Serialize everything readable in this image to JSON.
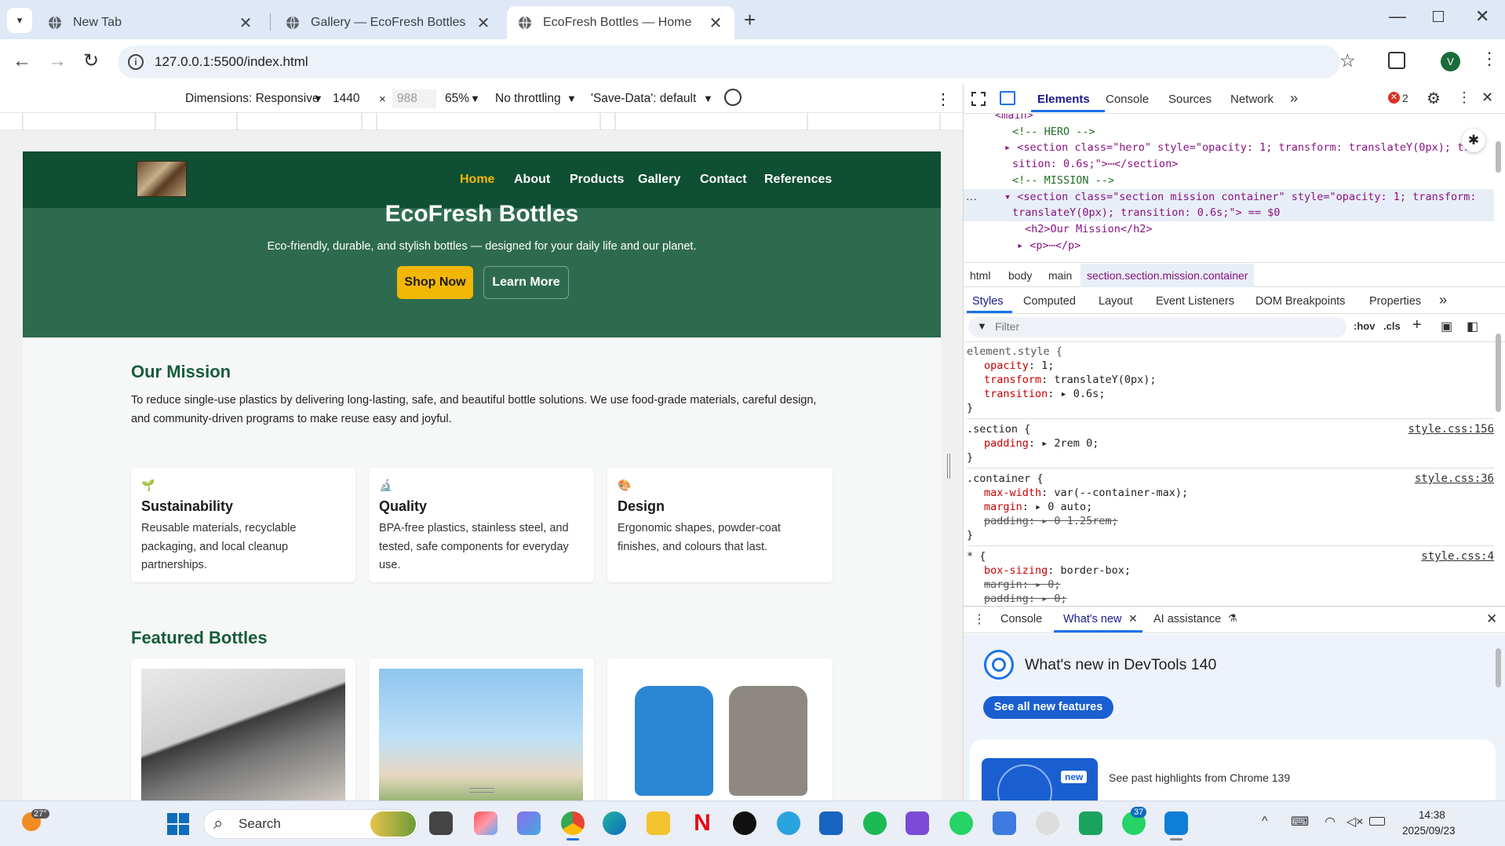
{
  "tabs": [
    {
      "title": "New Tab",
      "active": false
    },
    {
      "title": "Gallery — EcoFresh Bottles",
      "active": false
    },
    {
      "title": "EcoFresh Bottles — Home",
      "active": true
    }
  ],
  "address": {
    "url": "127.0.0.1:5500/index.html"
  },
  "profile": {
    "initial": "V"
  },
  "device_toolbar": {
    "dimensions": "Dimensions: Responsive",
    "width": "1440",
    "height_placeholder": "988",
    "times": "×",
    "zoom": "65%",
    "throttle": "No throttling",
    "save_data": "'Save-Data': default"
  },
  "site": {
    "nav": [
      "Home",
      "About",
      "Products",
      "Gallery",
      "Contact",
      "References"
    ],
    "hero_title": "EcoFresh Bottles",
    "hero_subtitle": "Eco-friendly, durable, and stylish bottles — designed for your daily life and our planet.",
    "shop_btn": "Shop Now",
    "learn_btn": "Learn More",
    "mission_title": "Our Mission",
    "mission_text": "To reduce single-use plastics by delivering long-lasting, safe, and beautiful bottle solutions. We use food-grade materials, careful design, and community-driven programs to make reuse easy and joyful.",
    "features": [
      {
        "icon": "🌱",
        "title": "Sustainability",
        "text": "Reusable materials, recyclable packaging, and local cleanup partnerships."
      },
      {
        "icon": "🔬",
        "title": "Quality",
        "text": "BPA-free plastics, stainless steel, and tested, safe components for everyday use."
      },
      {
        "icon": "🎨",
        "title": "Design",
        "text": "Ergonomic shapes, powder-coat finishes, and colours that last."
      }
    ],
    "featured_title": "Featured Bottles"
  },
  "devtools": {
    "tabs": [
      "Elements",
      "Console",
      "Sources",
      "Network"
    ],
    "active_tab": "Elements",
    "error_count": "2",
    "dom_lines": [
      "<main>",
      "<!-- HERO -->",
      "<section class=\"hero\" style=\"opacity: 1; transform: translateY(0px); tra",
      "sition: 0.6s;\">⋯</section>",
      "<!-- MISSION -->",
      "<section class=\"section mission container\" style=\"opacity: 1; transform:",
      "translateY(0px); transition: 0.6s;\"> == $0",
      "<h2>Our Mission</h2>",
      "<p>⋯</p>"
    ],
    "breadcrumbs": [
      "html",
      "body",
      "main",
      "section.section.mission.container"
    ],
    "style_tabs": [
      "Styles",
      "Computed",
      "Layout",
      "Event Listeners",
      "DOM Breakpoints",
      "Properties"
    ],
    "filter_placeholder": "Filter",
    "hov": ":hov",
    "cls": ".cls",
    "rules": [
      {
        "selector": "element.style {",
        "source": "",
        "decls": [
          [
            "opacity",
            "1;"
          ],
          [
            "transform",
            "translateY(0px);"
          ],
          [
            "transition",
            "▸ 0.6s;"
          ]
        ]
      },
      {
        "selector": ".section {",
        "source": "style.css:156",
        "decls": [
          [
            "padding",
            "▸ 2rem 0;"
          ]
        ]
      },
      {
        "selector": ".container {",
        "source": "style.css:36",
        "decls": [
          [
            "max-width",
            "var(--container-max);"
          ],
          [
            "margin",
            "▸ 0 auto;"
          ],
          [
            "padding",
            "▸ 0 1.25rem;"
          ]
        ]
      },
      {
        "selector": "* {",
        "source": "style.css:4",
        "decls": [
          [
            "box-sizing",
            "border-box;"
          ],
          [
            "margin",
            "▸ 0;"
          ],
          [
            "padding",
            "▸ 0;"
          ]
        ]
      }
    ],
    "drawer_tabs": [
      "Console",
      "What's new",
      "AI assistance"
    ],
    "whats_new_title": "What's new in DevTools 140",
    "see_all": "See all new features",
    "new_badge": "new",
    "past_highlights": "See past highlights from Chrome 139"
  },
  "taskbar": {
    "weather": "27°",
    "search": "Search",
    "badge_count": "37",
    "time": "14:38",
    "date": "2025/09/23"
  },
  "colors": {
    "nav_green": "#0f4f33",
    "hero_green": "#2e6b4e",
    "accent_yellow": "#f2b705",
    "mission_green": "#175c3b"
  }
}
